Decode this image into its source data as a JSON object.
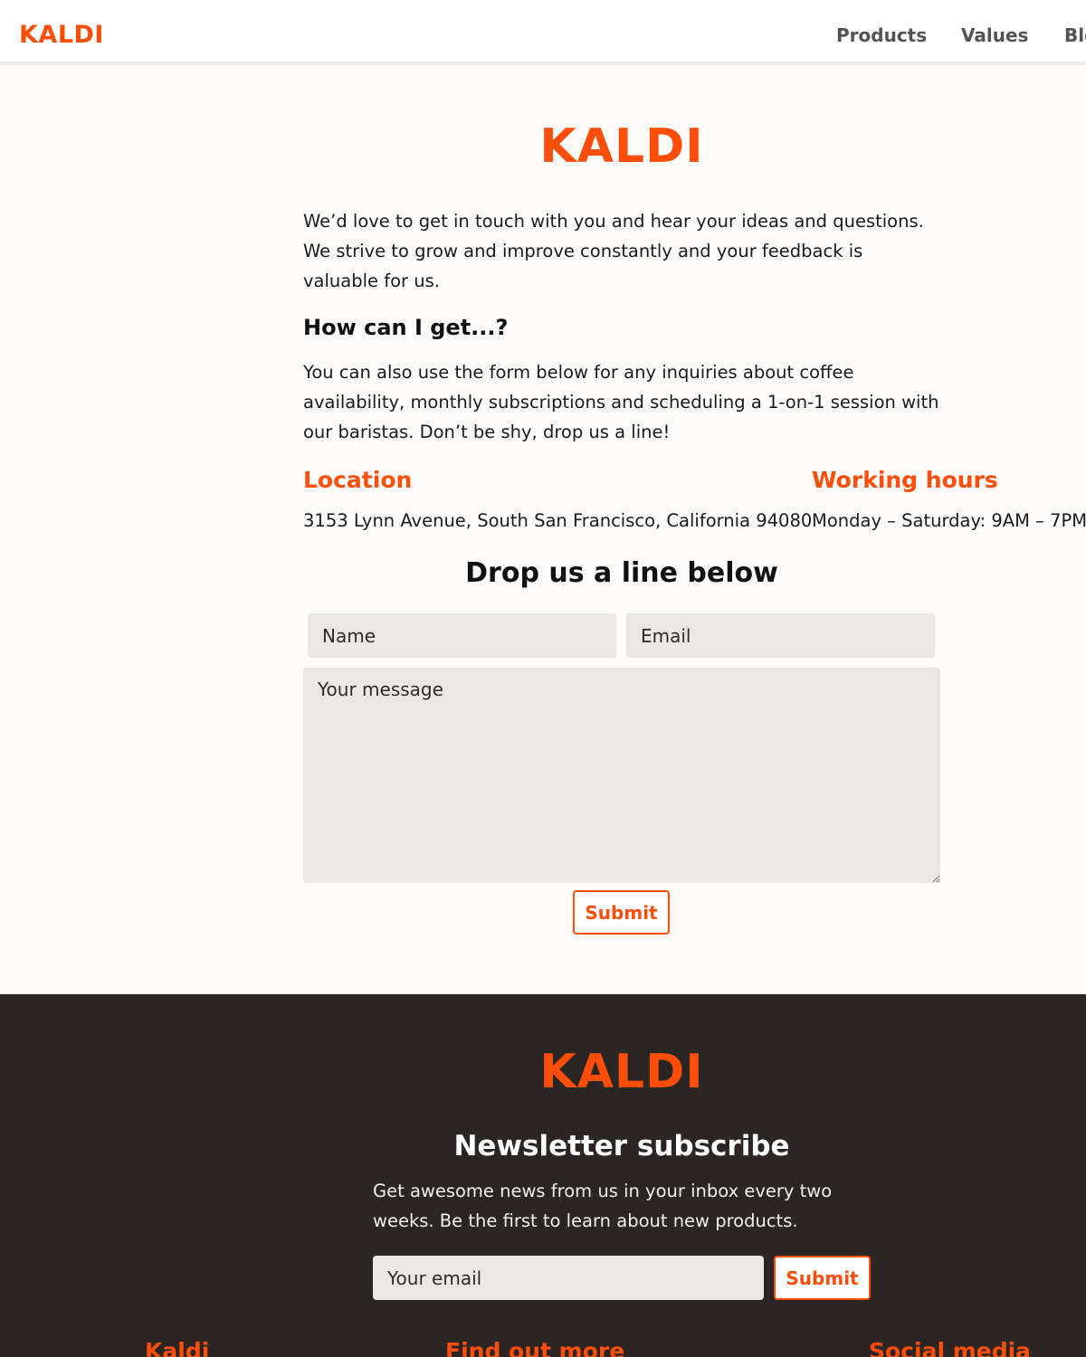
{
  "header": {
    "brand": "KALDI",
    "nav": [
      "Products",
      "Values",
      "Blog"
    ]
  },
  "main": {
    "logo": "KALDI",
    "intro": "We’d love to get in touch with you and hear your ideas and questions. We strive to grow and improve constantly and your feedback is valuable for us.",
    "how_heading": "How can I get...?",
    "how_text": "You can also use the form below for any inquiries about coffee availability, monthly subscriptions and scheduling a 1-on-1 session with our baristas. Don’t be shy, drop us a line!",
    "location_label": "Location",
    "location_value": "3153 Lynn Avenue, South San Francisco, California 94080",
    "hours_label": "Working hours",
    "hours_value": "Monday – Saturday: 9AM – 7PM",
    "form": {
      "heading": "Drop us a line below",
      "name_placeholder": "Name",
      "email_placeholder": "Email",
      "message_placeholder": "Your message",
      "submit_label": "Submit"
    }
  },
  "footer": {
    "logo": "KALDI",
    "newsletter_heading": "Newsletter subscribe",
    "newsletter_text": "Get awesome news from us in your inbox every two weeks. Be the first to learn about new products.",
    "email_placeholder": "Your email",
    "submit_label": "Submit",
    "columns": [
      "Kaldi",
      "Find out more",
      "Social media"
    ]
  },
  "colors": {
    "accent": "#ff4d0a",
    "footer_bg": "#2b2624",
    "field_bg": "#eae7e5"
  }
}
